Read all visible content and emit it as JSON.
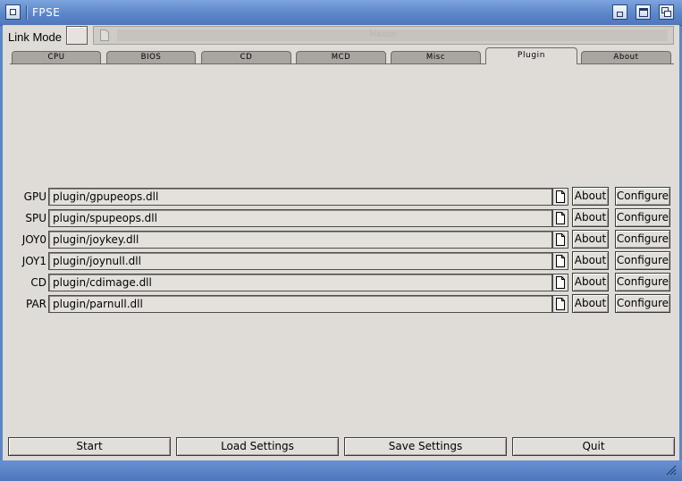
{
  "window": {
    "title": "FPSE"
  },
  "link_mode": {
    "label": "Link Mode",
    "field_text": "Master"
  },
  "tabs": [
    {
      "label": "CPU",
      "active": false
    },
    {
      "label": "BIOS",
      "active": false
    },
    {
      "label": "CD",
      "active": false
    },
    {
      "label": "MCD",
      "active": false
    },
    {
      "label": "Misc",
      "active": false
    },
    {
      "label": "Plugin",
      "active": true
    },
    {
      "label": "About",
      "active": false
    }
  ],
  "plugins": [
    {
      "label": "GPU",
      "path": "plugin/gpupeops.dll",
      "about": "About",
      "configure": "Configure"
    },
    {
      "label": "SPU",
      "path": "plugin/spupeops.dll",
      "about": "About",
      "configure": "Configure"
    },
    {
      "label": "JOY0",
      "path": "plugin/joykey.dll",
      "about": "About",
      "configure": "Configure"
    },
    {
      "label": "JOY1",
      "path": "plugin/joynull.dll",
      "about": "About",
      "configure": "Configure"
    },
    {
      "label": "CD",
      "path": "plugin/cdimage.dll",
      "about": "About",
      "configure": "Configure"
    },
    {
      "label": "PAR",
      "path": "plugin/parnull.dll",
      "about": "About",
      "configure": "Configure"
    }
  ],
  "footer": {
    "start": "Start",
    "load_settings": "Load Settings",
    "save_settings": "Save Settings",
    "quit": "Quit"
  },
  "icons": {
    "window_menu": "window-menu-icon",
    "minimize": "minimize-icon",
    "maximize": "maximize-icon",
    "restore": "restore-icon",
    "browse": "file-document-icon",
    "resize": "resize-grip-icon"
  },
  "colors": {
    "titlebar": "#5b86c9",
    "client_background": "#dfdcd7",
    "title_text": "#ffffff"
  }
}
